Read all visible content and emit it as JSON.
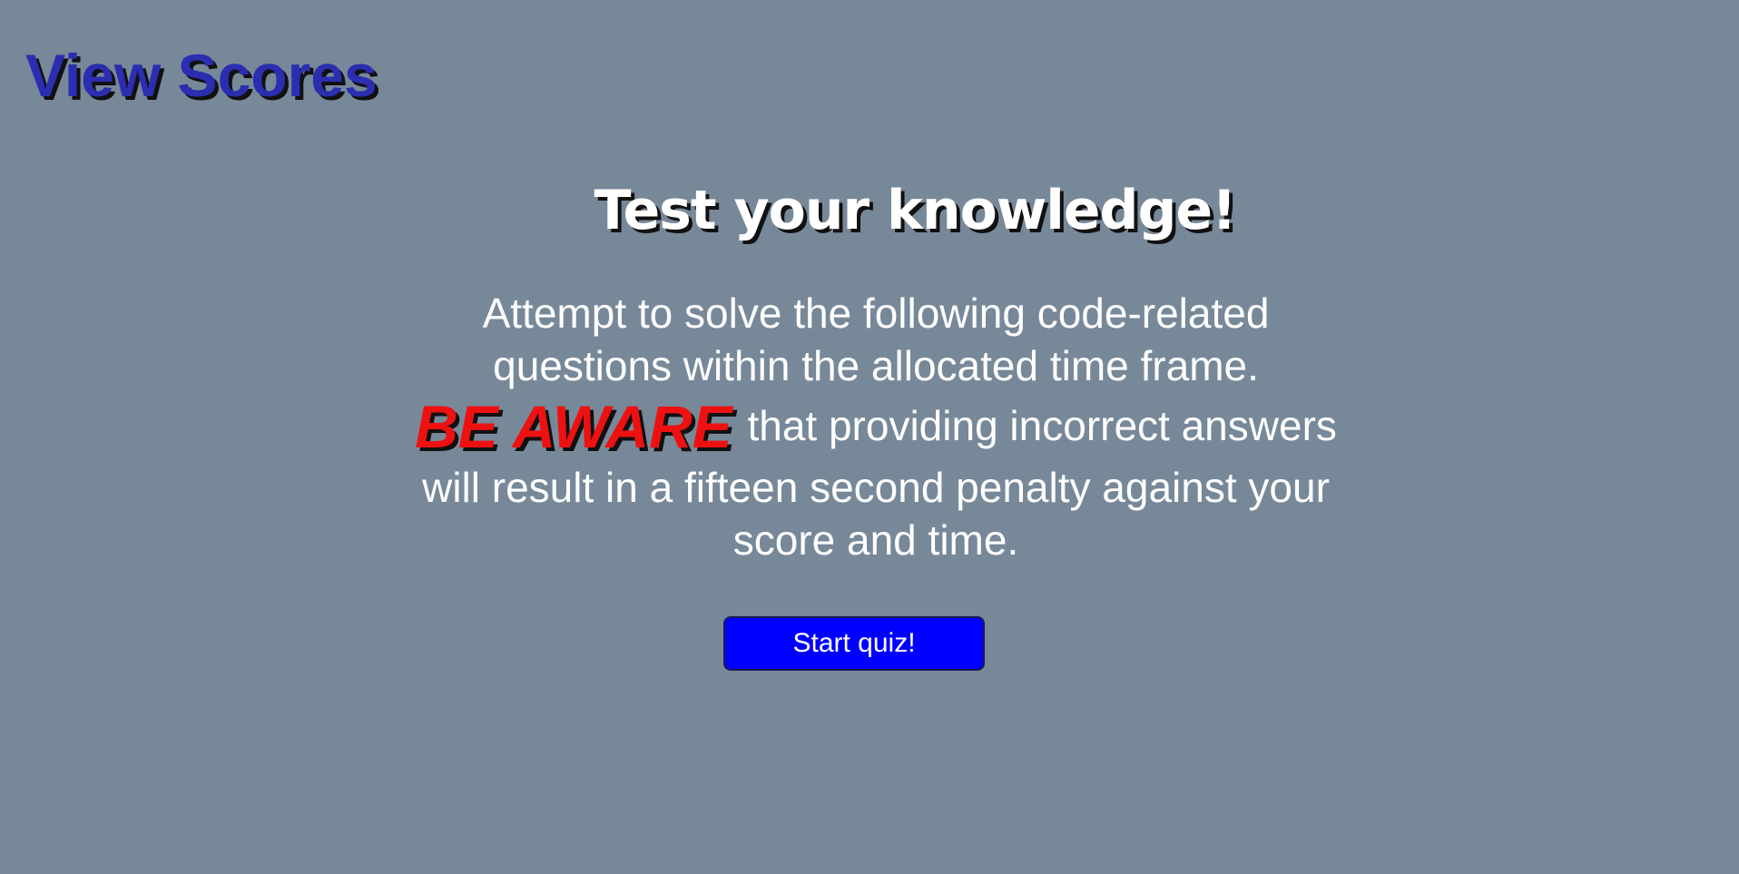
{
  "header": {
    "view_scores_label": "View Scores"
  },
  "main": {
    "title": "Test your knowledge!",
    "intro_before": "Attempt to solve the following code-related questions within the allocated time frame.",
    "warning_label": "BE AWARE",
    "intro_after": "that providing incorrect answers will result in a fifteen second penalty against your score and time.",
    "start_button_label": "Start quiz!"
  },
  "colors": {
    "background": "#778899",
    "link": "#2b2eb0",
    "warning": "#ee1111",
    "button": "#0000ff"
  }
}
